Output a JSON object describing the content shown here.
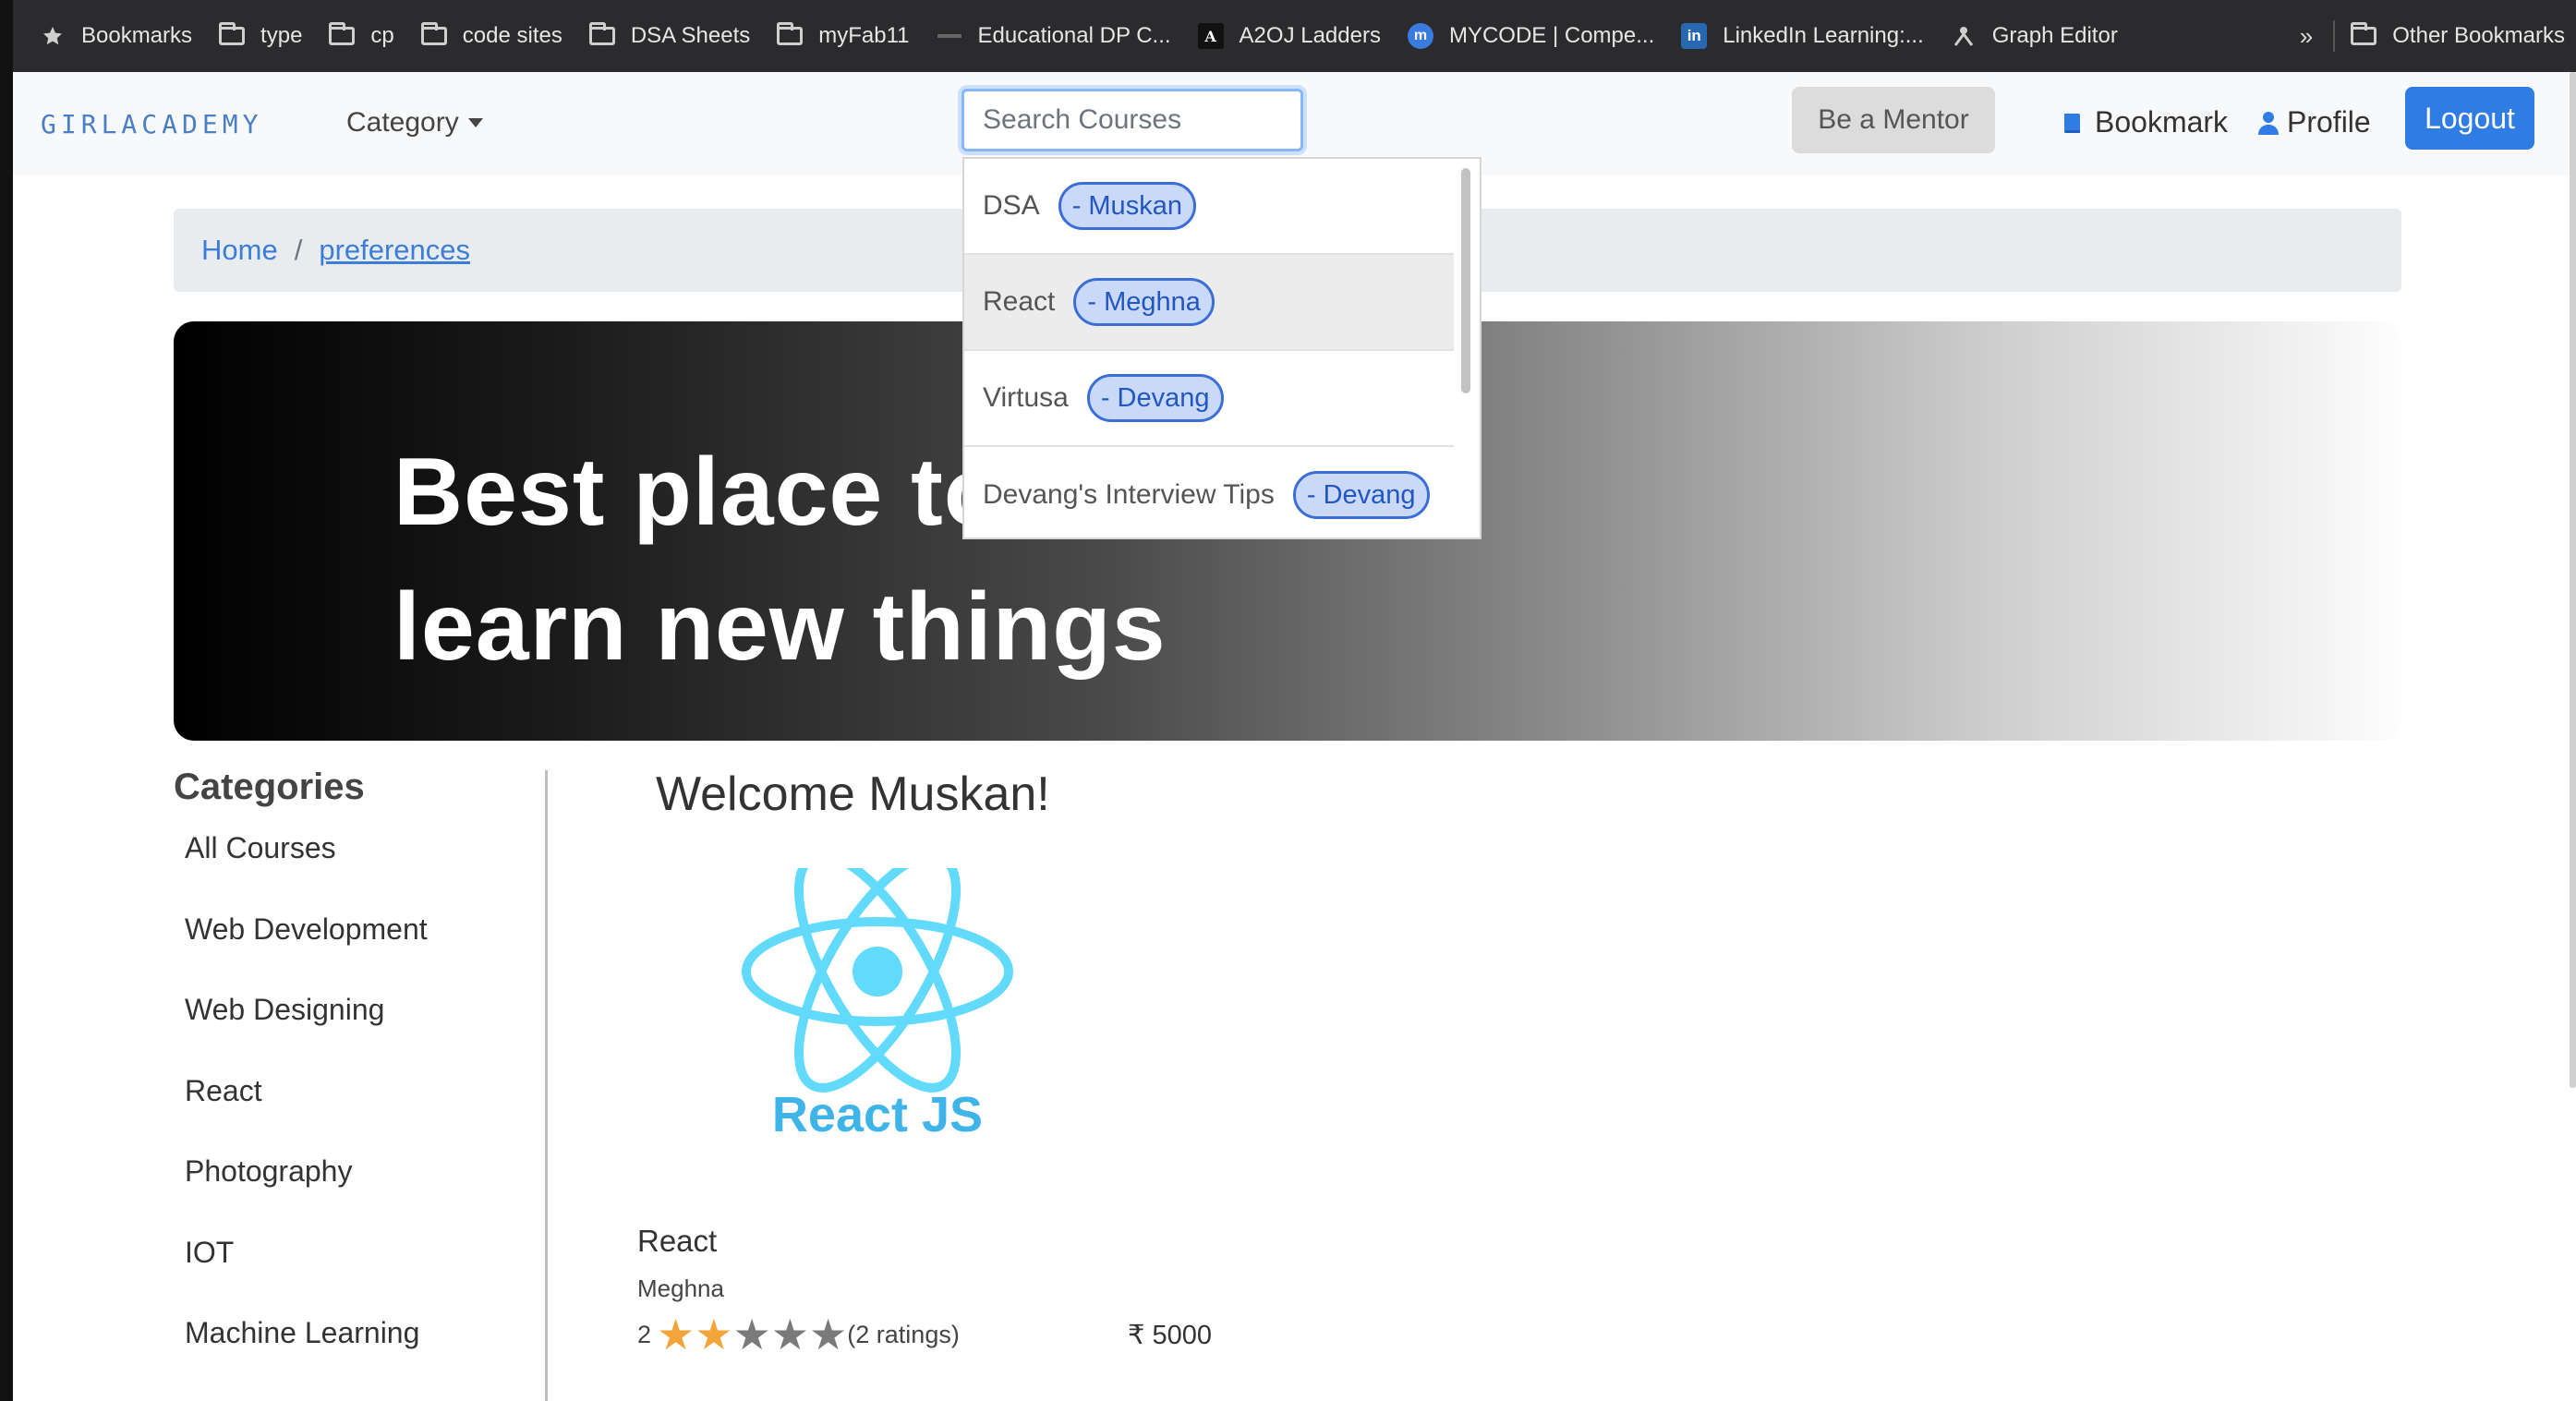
{
  "bookmarks": [
    {
      "label": "Bookmarks",
      "icon": "star-icon"
    },
    {
      "label": "type",
      "icon": "folder-icon"
    },
    {
      "label": "cp",
      "icon": "folder-icon"
    },
    {
      "label": "code sites",
      "icon": "folder-icon"
    },
    {
      "label": "DSA Sheets",
      "icon": "folder-icon"
    },
    {
      "label": "myFab11",
      "icon": "folder-icon"
    },
    {
      "label": "Educational DP C...",
      "icon": "site-favicon"
    },
    {
      "label": "A2OJ Ladders",
      "icon": "a2oj-favicon"
    },
    {
      "label": "MYCODE | Compe...",
      "icon": "mycode-favicon"
    },
    {
      "label": "LinkedIn Learning:...",
      "icon": "linkedin-icon"
    },
    {
      "label": "Graph Editor",
      "icon": "graph-favicon"
    }
  ],
  "bookmarks_more": "»",
  "bookmarks_other": "Other Bookmarks",
  "nav": {
    "brand": "GIRLACADEMY",
    "category": "Category",
    "search_placeholder": "Search Courses",
    "mentor": "Be a Mentor",
    "bookmark": "Bookmark",
    "profile": "Profile",
    "logout": "Logout"
  },
  "breadcrumb": {
    "home": "Home",
    "separator": "/",
    "current": "preferences"
  },
  "hero": {
    "line1": "Best place to",
    "line2": "learn new things"
  },
  "search_results": [
    {
      "course": "DSA",
      "author": "- Muskan"
    },
    {
      "course": "React",
      "author": "- Meghna"
    },
    {
      "course": "Virtusa",
      "author": "- Devang"
    },
    {
      "course": "Devang's Interview Tips",
      "author": "- Devang"
    }
  ],
  "categories": {
    "title": "Categories",
    "items": [
      "All Courses",
      "Web Development",
      "Web Designing",
      "React",
      "Photography",
      "IOT",
      "Machine Learning"
    ]
  },
  "welcome": "Welcome Muskan!",
  "course": {
    "logo_text": "React JS",
    "title": "React",
    "author": "Meghna",
    "rating": "2",
    "stars_filled": 2,
    "stars_total": 5,
    "ratings_count": "(2 ratings)",
    "price": "₹ 5000"
  },
  "colors": {
    "accent": "#2f7de4",
    "brand": "#4a7fc4",
    "react": "#61dafb",
    "star": "#f3a43b"
  }
}
